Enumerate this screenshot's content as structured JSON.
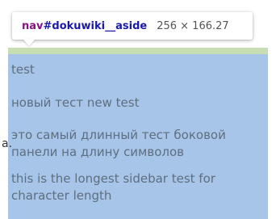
{
  "tooltip": {
    "tag": "nav",
    "id": "#dokuwiki__aside",
    "dimensions": "256 × 166.27"
  },
  "sidebar": {
    "items": [
      {
        "label": "test"
      },
      {
        "label": "новый тест new test"
      },
      {
        "label": "это самый длинный тест боковой панели на длину символов"
      },
      {
        "label": "this is the longest sidebar test for character length"
      }
    ]
  },
  "page": {
    "left_fragment": "a."
  },
  "colors": {
    "highlight": "#a7c4e9",
    "margin_strip": "#c7deb2",
    "tag": "#881280",
    "id": "#1a1aa6"
  }
}
